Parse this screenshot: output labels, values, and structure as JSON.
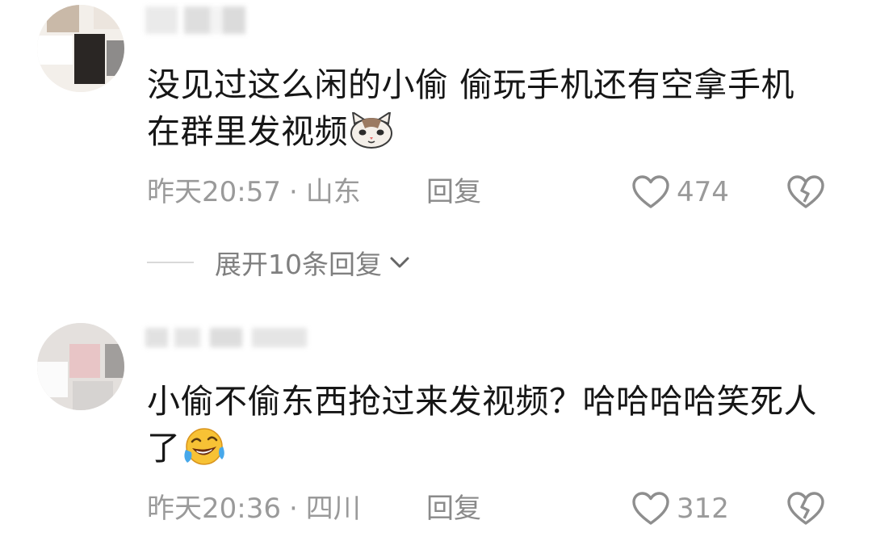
{
  "comments": [
    {
      "text": "没见过这么闲的小偷 偷玩手机还有空拿手机在群里发视频",
      "emoji_icon": "cat-face-emoji",
      "time": "昨天20:57",
      "separator": "·",
      "location": "山东",
      "reply_label": "回复",
      "likes": "474"
    },
    {
      "text": "小偷不偷东西抢过来发视频？哈哈哈哈笑死人了",
      "emoji_icon": "rolling-laughing-emoji",
      "time": "昨天20:36",
      "separator": "·",
      "location": "四川",
      "reply_label": "回复",
      "likes": "312"
    }
  ],
  "expand_replies": "展开10条回复",
  "colors": {
    "text": "#161616",
    "meta": "#9a9a9a",
    "background": "#ffffff"
  }
}
